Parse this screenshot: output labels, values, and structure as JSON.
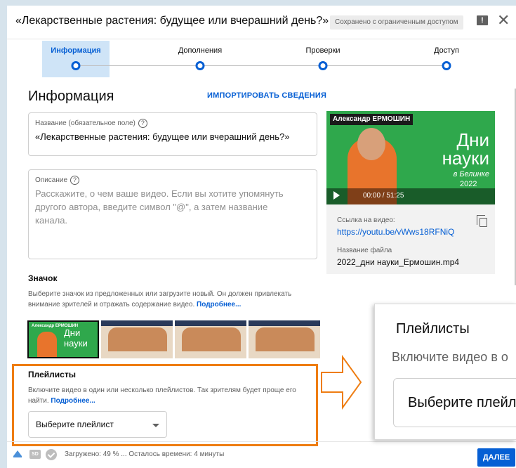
{
  "header": {
    "title": "«Лекарственные растения: будущее или вчерашний день?»",
    "badge": "Сохранено с ограниченным доступом"
  },
  "steps": [
    {
      "label": "Информация"
    },
    {
      "label": "Дополнения"
    },
    {
      "label": "Проверки"
    },
    {
      "label": "Доступ"
    }
  ],
  "info": {
    "heading": "Информация",
    "import_link": "ИМПОРТИРОВАТЬ СВЕДЕНИЯ",
    "title_label": "Название (обязательное поле)",
    "title_value": "«Лекарственные растения: будущее или вчерашний день?»",
    "desc_label": "Описание",
    "desc_placeholder": "Расскажите, о чем ваше видео. Если вы хотите упомянуть другого автора, введите символ \"@\", а затем название канала."
  },
  "video": {
    "thumb_name": "Александр ЕРМОШИН",
    "thumb_title": "Дни науки",
    "thumb_sub": "в Белинке",
    "thumb_year": "2022",
    "time": "00:00 / 51:25",
    "link_label": "Ссылка на видео:",
    "link": "https://youtu.be/vWws18RFNiQ",
    "file_label": "Название файла",
    "file": "2022_дни науки_Ермошин.mp4"
  },
  "thumbnail": {
    "heading": "Значок",
    "text": "Выберите значок из предложенных или загрузите новый. Он должен привлекать внимание зрителей и отражать содержание видео.",
    "more": "Подробнее...",
    "mini_name": "Александр ЕРМОШИН",
    "mini_title": "Дни науки"
  },
  "playlists": {
    "heading": "Плейлисты",
    "text": "Включите видео в один или несколько плейлистов. Так зрителям будет проще его найти.",
    "more": "Подробнее...",
    "select": "Выберите плейлист"
  },
  "zoom": {
    "heading": "Плейлисты",
    "text": "Включите видео в о",
    "select": "Выберите плейл"
  },
  "footer": {
    "sd": "SD",
    "status": "Загружено: 49 % ... Осталось времени: 4 минуты",
    "next": "ДАЛЕЕ"
  },
  "colors": {
    "accent": "#065fd4",
    "highlight": "#ee7d12",
    "background": "#d6e3ec"
  }
}
